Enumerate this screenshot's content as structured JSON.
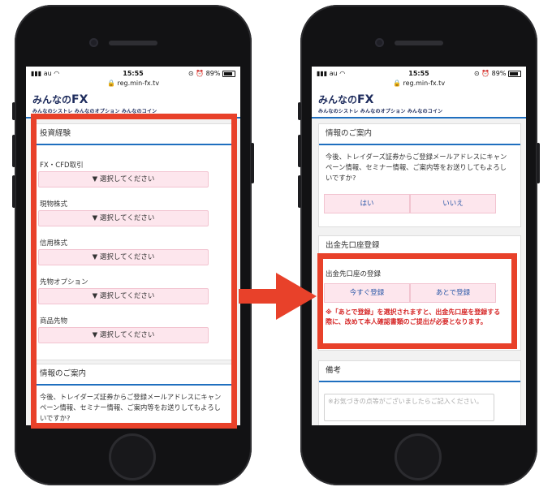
{
  "status": {
    "carrier": "au",
    "time": "15:55",
    "battery_pct": "89%"
  },
  "url": "reg.min-fx.tv",
  "logo": {
    "prefix": "みんなの",
    "fx": "FX",
    "sub": "みんなのシストレ みんなのオプション みんなのコイン"
  },
  "left_screen": {
    "investment": {
      "title": "投資経験",
      "fields": [
        {
          "label": "FX・CFD取引",
          "select": "▼ 選択してください"
        },
        {
          "label": "現物株式",
          "select": "▼ 選択してください"
        },
        {
          "label": "信用株式",
          "select": "▼ 選択してください"
        },
        {
          "label": "先物オプション",
          "select": "▼ 選択してください"
        },
        {
          "label": "商品先物",
          "select": "▼ 選択してください"
        }
      ]
    },
    "info": {
      "title": "情報のご案内",
      "text": "今後、トレイダーズ証券からご登録メールアドレスにキャンペーン情報、セミナー情報、ご案内等をお送りしてもよろしいですか?"
    }
  },
  "right_screen": {
    "info": {
      "title": "情報のご案内",
      "text": "今後、トレイダーズ証券からご登録メールアドレスにキャンペーン情報、セミナー情報、ご案内等をお送りしてもよろしいですか?",
      "yes": "はい",
      "no": "いいえ"
    },
    "withdraw": {
      "title": "出金先口座登録",
      "label": "出金先口座の登録",
      "now": "今すぐ登録",
      "later": "あとで登録",
      "warning": "※「あとで登録」を選択されますと、出金先口座を登録する際に、改めて本人確認書類のご提出が必要となります。"
    },
    "remarks": {
      "title": "備考",
      "placeholder": "※お気づきの点等がございましたらご記入ください。"
    }
  },
  "colors": {
    "highlight": "#e8412a",
    "accent": "#1f6fbf",
    "button_bg": "#fde6ed",
    "warning": "#d62828"
  }
}
